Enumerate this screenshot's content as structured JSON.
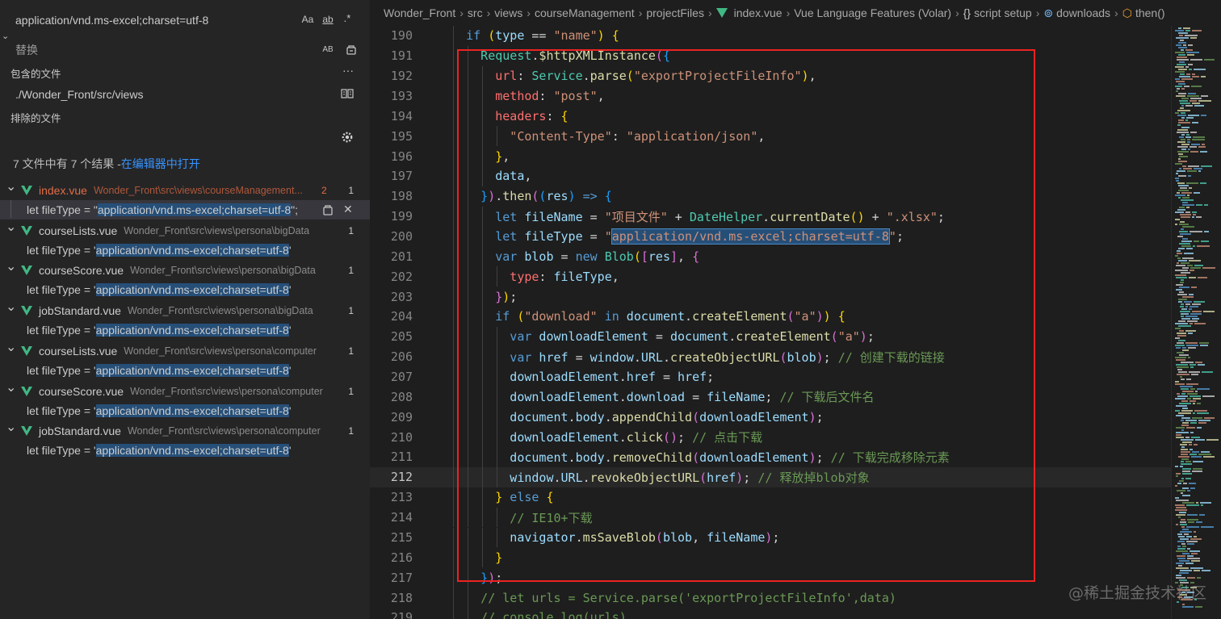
{
  "search": {
    "query": "application/vnd.ms-excel;charset=utf-8",
    "toggles": [
      "Aa",
      "ab",
      ".*"
    ],
    "replace_placeholder": "替换",
    "replace_toggle": "AB",
    "include_label": "包含的文件",
    "include_value": "./Wonder_Front/src/views",
    "exclude_label": "排除的文件",
    "summary": "7 文件中有 7 个结果 - ",
    "open_in_editor": "在编辑器中打开"
  },
  "results": [
    {
      "file": "index.vue",
      "path": "Wonder_Front\\src\\views\\courseManagement...",
      "modified_count": "2",
      "count": "1",
      "modified": true,
      "match_prefix": "let fileType = \"",
      "match_hl": "application/vnd.ms-excel;charset=utf-8",
      "match_suffix": "\";"
    },
    {
      "file": "courseLists.vue",
      "path": "Wonder_Front\\src\\views\\persona\\bigData",
      "count": "1",
      "match_prefix": "let fileType = '",
      "match_hl": "application/vnd.ms-excel;charset=utf-8",
      "match_suffix": "'"
    },
    {
      "file": "courseScore.vue",
      "path": "Wonder_Front\\src\\views\\persona\\bigData",
      "count": "1",
      "match_prefix": "let fileType = '",
      "match_hl": "application/vnd.ms-excel;charset=utf-8",
      "match_suffix": "'"
    },
    {
      "file": "jobStandard.vue",
      "path": "Wonder_Front\\src\\views\\persona\\bigData",
      "count": "1",
      "match_prefix": "let fileType = '",
      "match_hl": "application/vnd.ms-excel;charset=utf-8",
      "match_suffix": "'"
    },
    {
      "file": "courseLists.vue",
      "path": "Wonder_Front\\src\\views\\persona\\computer",
      "count": "1",
      "match_prefix": "let fileType = '",
      "match_hl": "application/vnd.ms-excel;charset=utf-8",
      "match_suffix": "'"
    },
    {
      "file": "courseScore.vue",
      "path": "Wonder_Front\\src\\views\\persona\\computer",
      "count": "1",
      "match_prefix": "let fileType = '",
      "match_hl": "application/vnd.ms-excel;charset=utf-8",
      "match_suffix": "'"
    },
    {
      "file": "jobStandard.vue",
      "path": "Wonder_Front\\src\\views\\persona\\computer",
      "count": "1",
      "match_prefix": "let fileType = '",
      "match_hl": "application/vnd.ms-excel;charset=utf-8",
      "match_suffix": "'"
    }
  ],
  "breadcrumb": [
    "Wonder_Front",
    "src",
    "views",
    "courseManagement",
    "projectFiles",
    "index.vue",
    "Vue Language Features (Volar)",
    "script setup",
    "downloads",
    "then()"
  ],
  "breadcrumb_icons": {
    "vue": "vue-file-icon",
    "braces": "{}",
    "method": "method-icon",
    "function": "function-icon"
  },
  "code": {
    "active_line": 212,
    "lines": [
      {
        "n": 190,
        "indent": 2,
        "tokens": [
          [
            "k",
            "if"
          ],
          [
            "pun",
            " "
          ],
          [
            "br1",
            "("
          ],
          [
            "v",
            "type"
          ],
          [
            "pun",
            " == "
          ],
          [
            "s",
            "\"name\""
          ],
          [
            "br1",
            ")"
          ],
          [
            "pun",
            " "
          ],
          [
            "br1",
            "{"
          ]
        ]
      },
      {
        "n": 191,
        "indent": 3,
        "tokens": [
          [
            "cls",
            "Request"
          ],
          [
            "pun",
            "."
          ],
          [
            "f",
            "$httpXMLInstance"
          ],
          [
            "br2",
            "("
          ],
          [
            "br3",
            "{"
          ]
        ]
      },
      {
        "n": 192,
        "indent": 4,
        "tokens": [
          [
            "p",
            "url"
          ],
          [
            "pun",
            ": "
          ],
          [
            "cls",
            "Service"
          ],
          [
            "pun",
            "."
          ],
          [
            "f",
            "parse"
          ],
          [
            "br1",
            "("
          ],
          [
            "s",
            "\"exportProjectFileInfo\""
          ],
          [
            "br1",
            ")"
          ],
          [
            "pun",
            ","
          ]
        ]
      },
      {
        "n": 193,
        "indent": 4,
        "tokens": [
          [
            "p",
            "method"
          ],
          [
            "pun",
            ": "
          ],
          [
            "s",
            "\"post\""
          ],
          [
            "pun",
            ","
          ]
        ]
      },
      {
        "n": 194,
        "indent": 4,
        "tokens": [
          [
            "p",
            "headers"
          ],
          [
            "pun",
            ": "
          ],
          [
            "br1",
            "{"
          ]
        ]
      },
      {
        "n": 195,
        "indent": 5,
        "tokens": [
          [
            "s",
            "\"Content-Type\""
          ],
          [
            "pun",
            ": "
          ],
          [
            "s",
            "\"application/json\""
          ],
          [
            "pun",
            ","
          ]
        ]
      },
      {
        "n": 196,
        "indent": 4,
        "tokens": [
          [
            "br1",
            "}"
          ],
          [
            "pun",
            ","
          ]
        ]
      },
      {
        "n": 197,
        "indent": 4,
        "tokens": [
          [
            "v",
            "data"
          ],
          [
            "pun",
            ","
          ]
        ]
      },
      {
        "n": 198,
        "indent": 3,
        "tokens": [
          [
            "br3",
            "}"
          ],
          [
            "br2",
            ")"
          ],
          [
            "pun",
            "."
          ],
          [
            "f",
            "then"
          ],
          [
            "br2",
            "("
          ],
          [
            "br3",
            "("
          ],
          [
            "v",
            "res"
          ],
          [
            "br3",
            ")"
          ],
          [
            "pun",
            " "
          ],
          [
            "k",
            "=>"
          ],
          [
            "pun",
            " "
          ],
          [
            "br3",
            "{"
          ]
        ]
      },
      {
        "n": 199,
        "indent": 4,
        "tokens": [
          [
            "k",
            "let"
          ],
          [
            "pun",
            " "
          ],
          [
            "v",
            "fileName"
          ],
          [
            "pun",
            " = "
          ],
          [
            "s",
            "\"项目文件\""
          ],
          [
            "pun",
            " + "
          ],
          [
            "cls",
            "DateHelper"
          ],
          [
            "pun",
            "."
          ],
          [
            "f",
            "currentDate"
          ],
          [
            "br1",
            "()"
          ],
          [
            "pun",
            " + "
          ],
          [
            "s",
            "\".xlsx\""
          ],
          [
            "pun",
            ";"
          ]
        ]
      },
      {
        "n": 200,
        "indent": 4,
        "tokens": [
          [
            "k",
            "let"
          ],
          [
            "pun",
            " "
          ],
          [
            "v",
            "fileType"
          ],
          [
            "pun",
            " = "
          ],
          [
            "s",
            "\""
          ],
          [
            "s hlsel",
            "application/vnd.ms-excel;charset=utf-8"
          ],
          [
            "s",
            "\""
          ],
          [
            "pun",
            ";"
          ]
        ]
      },
      {
        "n": 201,
        "indent": 4,
        "tokens": [
          [
            "k",
            "var"
          ],
          [
            "pun",
            " "
          ],
          [
            "v",
            "blob"
          ],
          [
            "pun",
            " = "
          ],
          [
            "k",
            "new"
          ],
          [
            "pun",
            " "
          ],
          [
            "cls",
            "Blob"
          ],
          [
            "br1",
            "("
          ],
          [
            "br2",
            "["
          ],
          [
            "v",
            "res"
          ],
          [
            "br2",
            "]"
          ],
          [
            "pun",
            ", "
          ],
          [
            "br2",
            "{"
          ]
        ]
      },
      {
        "n": 202,
        "indent": 5,
        "tokens": [
          [
            "p",
            "type"
          ],
          [
            "pun",
            ": "
          ],
          [
            "v",
            "fileType"
          ],
          [
            "pun",
            ","
          ]
        ]
      },
      {
        "n": 203,
        "indent": 4,
        "tokens": [
          [
            "br2",
            "}"
          ],
          [
            "br1",
            ")"
          ],
          [
            "pun",
            ";"
          ]
        ]
      },
      {
        "n": 204,
        "indent": 4,
        "tokens": [
          [
            "k",
            "if"
          ],
          [
            "pun",
            " "
          ],
          [
            "br1",
            "("
          ],
          [
            "s",
            "\"download\""
          ],
          [
            "pun",
            " "
          ],
          [
            "k",
            "in"
          ],
          [
            "pun",
            " "
          ],
          [
            "v",
            "document"
          ],
          [
            "pun",
            "."
          ],
          [
            "f",
            "createElement"
          ],
          [
            "br2",
            "("
          ],
          [
            "s",
            "\"a\""
          ],
          [
            "br2",
            ")"
          ],
          [
            "br1",
            ")"
          ],
          [
            "pun",
            " "
          ],
          [
            "br1",
            "{"
          ]
        ]
      },
      {
        "n": 205,
        "indent": 5,
        "tokens": [
          [
            "k",
            "var"
          ],
          [
            "pun",
            " "
          ],
          [
            "v",
            "downloadElement"
          ],
          [
            "pun",
            " = "
          ],
          [
            "v",
            "document"
          ],
          [
            "pun",
            "."
          ],
          [
            "f",
            "createElement"
          ],
          [
            "br2",
            "("
          ],
          [
            "s",
            "\"a\""
          ],
          [
            "br2",
            ")"
          ],
          [
            "pun",
            ";"
          ]
        ]
      },
      {
        "n": 206,
        "indent": 5,
        "tokens": [
          [
            "k",
            "var"
          ],
          [
            "pun",
            " "
          ],
          [
            "v",
            "href"
          ],
          [
            "pun",
            " = "
          ],
          [
            "v",
            "window"
          ],
          [
            "pun",
            "."
          ],
          [
            "v",
            "URL"
          ],
          [
            "pun",
            "."
          ],
          [
            "f",
            "createObjectURL"
          ],
          [
            "br2",
            "("
          ],
          [
            "v",
            "blob"
          ],
          [
            "br2",
            ")"
          ],
          [
            "pun",
            "; "
          ],
          [
            "c",
            "// 创建下载的链接"
          ]
        ]
      },
      {
        "n": 207,
        "indent": 5,
        "tokens": [
          [
            "v",
            "downloadElement"
          ],
          [
            "pun",
            "."
          ],
          [
            "v",
            "href"
          ],
          [
            "pun",
            " = "
          ],
          [
            "v",
            "href"
          ],
          [
            "pun",
            ";"
          ]
        ]
      },
      {
        "n": 208,
        "indent": 5,
        "tokens": [
          [
            "v",
            "downloadElement"
          ],
          [
            "pun",
            "."
          ],
          [
            "v",
            "download"
          ],
          [
            "pun",
            " = "
          ],
          [
            "v",
            "fileName"
          ],
          [
            "pun",
            "; "
          ],
          [
            "c",
            "// 下载后文件名"
          ]
        ]
      },
      {
        "n": 209,
        "indent": 5,
        "tokens": [
          [
            "v",
            "document"
          ],
          [
            "pun",
            "."
          ],
          [
            "v",
            "body"
          ],
          [
            "pun",
            "."
          ],
          [
            "f",
            "appendChild"
          ],
          [
            "br2",
            "("
          ],
          [
            "v",
            "downloadElement"
          ],
          [
            "br2",
            ")"
          ],
          [
            "pun",
            ";"
          ]
        ]
      },
      {
        "n": 210,
        "indent": 5,
        "tokens": [
          [
            "v",
            "downloadElement"
          ],
          [
            "pun",
            "."
          ],
          [
            "f",
            "click"
          ],
          [
            "br2",
            "()"
          ],
          [
            "pun",
            "; "
          ],
          [
            "c",
            "// 点击下载"
          ]
        ]
      },
      {
        "n": 211,
        "indent": 5,
        "tokens": [
          [
            "v",
            "document"
          ],
          [
            "pun",
            "."
          ],
          [
            "v",
            "body"
          ],
          [
            "pun",
            "."
          ],
          [
            "f",
            "removeChild"
          ],
          [
            "br2",
            "("
          ],
          [
            "v",
            "downloadElement"
          ],
          [
            "br2",
            ")"
          ],
          [
            "pun",
            "; "
          ],
          [
            "c",
            "// 下载完成移除元素"
          ]
        ]
      },
      {
        "n": 212,
        "indent": 5,
        "tokens": [
          [
            "v",
            "window"
          ],
          [
            "pun",
            "."
          ],
          [
            "v",
            "URL"
          ],
          [
            "pun",
            "."
          ],
          [
            "f",
            "revokeObjectURL"
          ],
          [
            "br2",
            "("
          ],
          [
            "v",
            "href"
          ],
          [
            "br2",
            ")"
          ],
          [
            "pun",
            "; "
          ],
          [
            "c",
            "// 释放掉blob对象"
          ]
        ]
      },
      {
        "n": 213,
        "indent": 4,
        "tokens": [
          [
            "br1",
            "}"
          ],
          [
            "pun",
            " "
          ],
          [
            "k",
            "else"
          ],
          [
            "pun",
            " "
          ],
          [
            "br1",
            "{"
          ]
        ]
      },
      {
        "n": 214,
        "indent": 5,
        "tokens": [
          [
            "c",
            "// IE10+下载"
          ]
        ]
      },
      {
        "n": 215,
        "indent": 5,
        "tokens": [
          [
            "v",
            "navigator"
          ],
          [
            "pun",
            "."
          ],
          [
            "f",
            "msSaveBlob"
          ],
          [
            "br2",
            "("
          ],
          [
            "v",
            "blob"
          ],
          [
            "pun",
            ", "
          ],
          [
            "v",
            "fileName"
          ],
          [
            "br2",
            ")"
          ],
          [
            "pun",
            ";"
          ]
        ]
      },
      {
        "n": 216,
        "indent": 4,
        "tokens": [
          [
            "br1",
            "}"
          ]
        ]
      },
      {
        "n": 217,
        "indent": 3,
        "tokens": [
          [
            "br3",
            "}"
          ],
          [
            "br2",
            ")"
          ],
          [
            "pun",
            ";"
          ]
        ]
      },
      {
        "n": 218,
        "indent": 3,
        "tokens": [
          [
            "c",
            "// let urls = Service.parse('exportProjectFileInfo',data)"
          ]
        ]
      },
      {
        "n": 219,
        "indent": 3,
        "tokens": [
          [
            "c",
            "// console.log(urls)"
          ]
        ]
      }
    ]
  },
  "watermark": "@稀土掘金技术社区"
}
